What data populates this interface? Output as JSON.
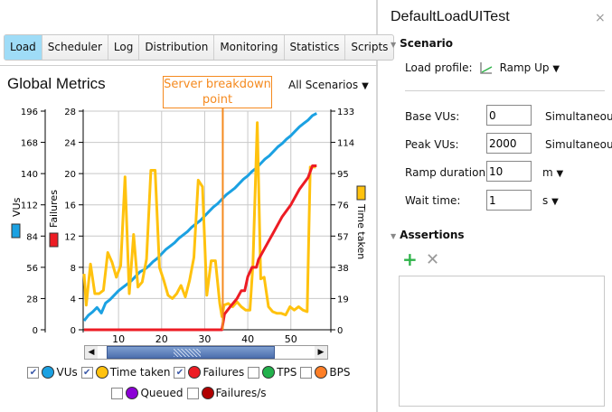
{
  "tabs": [
    {
      "label": "Load",
      "active": true
    },
    {
      "label": "Scheduler"
    },
    {
      "label": "Log"
    },
    {
      "label": "Distribution"
    },
    {
      "label": "Monitoring"
    },
    {
      "label": "Statistics"
    },
    {
      "label": "Scripts"
    }
  ],
  "metrics": {
    "title": "Global Metrics",
    "annotation": "Server breakdown point",
    "scenario_select": "All Scenarios"
  },
  "legend": [
    {
      "label": "VUs",
      "checked": true,
      "color": "#1ba1e2"
    },
    {
      "label": "Time taken",
      "checked": true,
      "color": "#ffc20e"
    },
    {
      "label": "Failures",
      "checked": true,
      "color": "#ed1c24"
    },
    {
      "label": "TPS",
      "checked": false,
      "color": "#22b14c"
    },
    {
      "label": "BPS",
      "checked": false,
      "color": "#ff7f27"
    },
    {
      "label": "Queued",
      "checked": false,
      "color": "#8b00d6"
    },
    {
      "label": "Failures/s",
      "checked": false,
      "color": "#b00000"
    }
  ],
  "chart_data": {
    "type": "line",
    "xlim": [
      2,
      59.5
    ],
    "x_ticks": [
      10,
      20,
      30,
      40,
      50
    ],
    "breakdown_x": 34.2,
    "axes": {
      "vus": {
        "label": "VUs",
        "ylim": [
          0,
          196
        ],
        "ticks": [
          0,
          28,
          56,
          84,
          112,
          140,
          168,
          196
        ],
        "color": "#1ba1e2"
      },
      "failures": {
        "label": "Failures",
        "ylim": [
          0,
          28
        ],
        "ticks": [
          0,
          4,
          8,
          12,
          16,
          20,
          24,
          28
        ],
        "color": "#ed1c24"
      },
      "time": {
        "label": "Time taken",
        "ylim": [
          0,
          133
        ],
        "ticks": [
          0,
          19,
          38,
          57,
          76,
          95,
          114,
          133
        ],
        "color": "#ffc20e"
      }
    },
    "series": [
      {
        "name": "VUs",
        "axis": "vus",
        "color": "#1ba1e2",
        "x": [
          2,
          3,
          4,
          5,
          6,
          7,
          8,
          9,
          10,
          11,
          12,
          13,
          14,
          15,
          16,
          17,
          18,
          19,
          20,
          21,
          22,
          23,
          24,
          25,
          26,
          27,
          28,
          29,
          30,
          31,
          32,
          33,
          34,
          35,
          36,
          37,
          38,
          39,
          40,
          41,
          42,
          43,
          44,
          45,
          46,
          47,
          48,
          49,
          50,
          51,
          52,
          53,
          54,
          55,
          56
        ],
        "y": [
          8,
          13,
          16,
          20,
          15,
          24,
          27,
          31,
          35,
          38,
          41,
          44,
          48,
          52,
          54,
          57,
          61,
          64,
          68,
          72,
          75,
          78,
          82,
          85,
          88,
          92,
          95,
          98,
          102,
          106,
          110,
          113,
          117,
          121,
          124,
          127,
          131,
          135,
          138,
          142,
          145,
          149,
          153,
          156,
          160,
          164,
          167,
          171,
          174,
          178,
          182,
          185,
          188,
          192,
          194
        ]
      },
      {
        "name": "Time taken",
        "axis": "time",
        "color": "#ffc20e",
        "x": [
          2,
          2.5,
          3.5,
          4.5,
          5.5,
          6.5,
          7.5,
          8.5,
          9.5,
          10.5,
          11.5,
          12.5,
          13.5,
          14.5,
          15.5,
          16.5,
          17.5,
          18.5,
          19.5,
          20.5,
          21.5,
          22.5,
          23.5,
          24.5,
          25.5,
          26.5,
          27.5,
          28.5,
          29.5,
          30.5,
          31.5,
          32.5,
          33.5,
          34,
          34.5,
          35.5,
          36.5,
          37.5,
          38.5,
          39.5,
          40.5,
          41.2,
          42.2,
          43,
          43.8,
          44.8,
          45.8,
          46.8,
          47.8,
          48.8,
          49.8,
          50.8,
          51.8,
          52.8,
          53.8,
          54.5,
          55.8
        ],
        "y": [
          34,
          15,
          40,
          22,
          22,
          24,
          47,
          41,
          32,
          39,
          93,
          22,
          58,
          26,
          29,
          43,
          97,
          97,
          38,
          30,
          21,
          19,
          22,
          27,
          20,
          30,
          44,
          91,
          87,
          21,
          42,
          42,
          16,
          8,
          15,
          16,
          14,
          17,
          14,
          12,
          12,
          40,
          126,
          31,
          32,
          14,
          11,
          10,
          10,
          9,
          14,
          12,
          14,
          12,
          11,
          99,
          99
        ]
      },
      {
        "name": "Failures",
        "axis": "failures",
        "color": "#ed1c24",
        "x": [
          2,
          34,
          34.6,
          36,
          37.5,
          38.5,
          39.3,
          40,
          41,
          42,
          42.5,
          44,
          46,
          48,
          50,
          52,
          54,
          55,
          56
        ],
        "y": [
          0,
          0,
          2,
          3,
          4,
          5,
          5,
          6.8,
          8,
          8,
          9,
          10.5,
          12.5,
          14.5,
          16,
          18,
          19.5,
          21,
          21
        ]
      }
    ]
  },
  "panel": {
    "title": "DefaultLoadUITest",
    "close": "×",
    "scenario_heading": "Scenario",
    "load_profile_label": "Load profile:",
    "load_profile_value": "Ramp Up",
    "base_vus_label": "Base VUs:",
    "base_vus_value": "0",
    "base_vus_unit": "Simultaneou",
    "peak_vus_label": "Peak VUs:",
    "peak_vus_value": "2000",
    "peak_vus_unit": "Simultaneou",
    "ramp_label": "Ramp duration:",
    "ramp_value": "10",
    "ramp_unit": "m",
    "wait_label": "Wait time:",
    "wait_value": "1",
    "wait_unit": "s",
    "assertions_heading": "Assertions",
    "add": "+",
    "remove": "✕"
  }
}
